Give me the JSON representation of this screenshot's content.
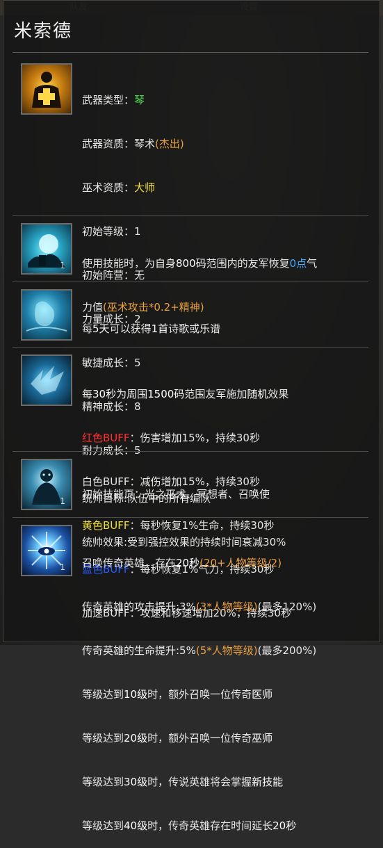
{
  "background": {
    "tabs": [
      "队友",
      "设置"
    ]
  },
  "hero_name": "米索德",
  "stats": {
    "weapon_type_label": "武器类型：",
    "weapon_type_value": "琴",
    "weapon_quality_label": "武器资质：",
    "weapon_quality_value": "琴术",
    "weapon_quality_paren_open": "(",
    "weapon_quality_grade": "杰出",
    "weapon_quality_paren_close": ")",
    "sorcery_quality_label": "巫术资质：",
    "sorcery_quality_value": "大师",
    "initial_level": "初始等级：1",
    "initial_camp": "初始阵营：无",
    "str_growth": "力量成长：2",
    "agi_growth": "敏捷成长：5",
    "spi_growth": "精神成长：8",
    "end_growth": "耐力成长：5",
    "initial_skills": "初始技能页：光之巫术、冥想者、召唤使"
  },
  "skill1": {
    "line1_a": "使用技能时，为自身",
    "line1_b": "800码",
    "line1_c": "范围内的友军恢复",
    "line1_d": "0点",
    "line1_e": "气",
    "line2_a": "力值",
    "line2_b": "(巫术攻击*0.2+精神)",
    "level": "1"
  },
  "skill2": {
    "a": "每",
    "b": "5天",
    "c": "可以获得",
    "d": "1首",
    "e": "诗歌或乐谱"
  },
  "skill3": {
    "l1_a": "每",
    "l1_b": "30秒",
    "l1_c": "为周围",
    "l1_d": "1500码",
    "l1_e": "范围友军施加",
    "l1_f": "随机",
    "l1_g": "效果",
    "red_label": "红色BUFF",
    "red_text": "：伤害增加15%，持续30秒",
    "white_label": "白色BUFF",
    "white_text": "：减伤增加15%，持续30秒",
    "yellow_label": "黄色BUFF",
    "yellow_text": "：每秒恢复1%生命，持续30秒",
    "blue_label": "蓝色BUFF",
    "blue_text": "：每秒恢复1%气力，持续30秒",
    "speed_label": "加速BUFF",
    "speed_text": "：攻速和移速增加20%，持续30秒"
  },
  "skill4": {
    "l1_a": "统帅目标:队伍中的",
    "l1_b": "所有",
    "l1_c": "编队",
    "l2": "统帅效果:受到强控效果的持续时间衰减30%",
    "level": "1"
  },
  "skill5": {
    "l1_a": "召唤传奇英雄，存在",
    "l1_b": "20秒",
    "l1_c": "(20+人物等级/2)",
    "l2_a": "传奇英雄的攻击提升:3%",
    "l2_b": "(3*人物等级)",
    "l2_c": "(最多120%)",
    "l3_a": "传奇英雄的生命提升:5%",
    "l3_b": "(5*人物等级)",
    "l3_c": "(最多200%)",
    "l4_a": "等级达到",
    "l4_b": "10级",
    "l4_c": "时，额外召唤一位传奇",
    "l4_d": "医师",
    "l5_a": "等级达到",
    "l5_b": "20级",
    "l5_c": "时，额外召唤一位传奇",
    "l5_d": "巫师",
    "l6_a": "等级达到",
    "l6_b": "30级",
    "l6_c": "时，传说英雄将会掌握",
    "l6_d": "新技能",
    "l7_a": "等级达到",
    "l7_b": "40级",
    "l7_c": "时，传奇英雄存在时间延长",
    "l7_d": "20秒",
    "level": "1"
  },
  "colors": {
    "green": "#4ee04e",
    "orange": "#e8a040",
    "yellow": "#f0e040",
    "red": "#ff3030",
    "blue": "#2a5cff",
    "skyblue": "#4aa8ff"
  }
}
